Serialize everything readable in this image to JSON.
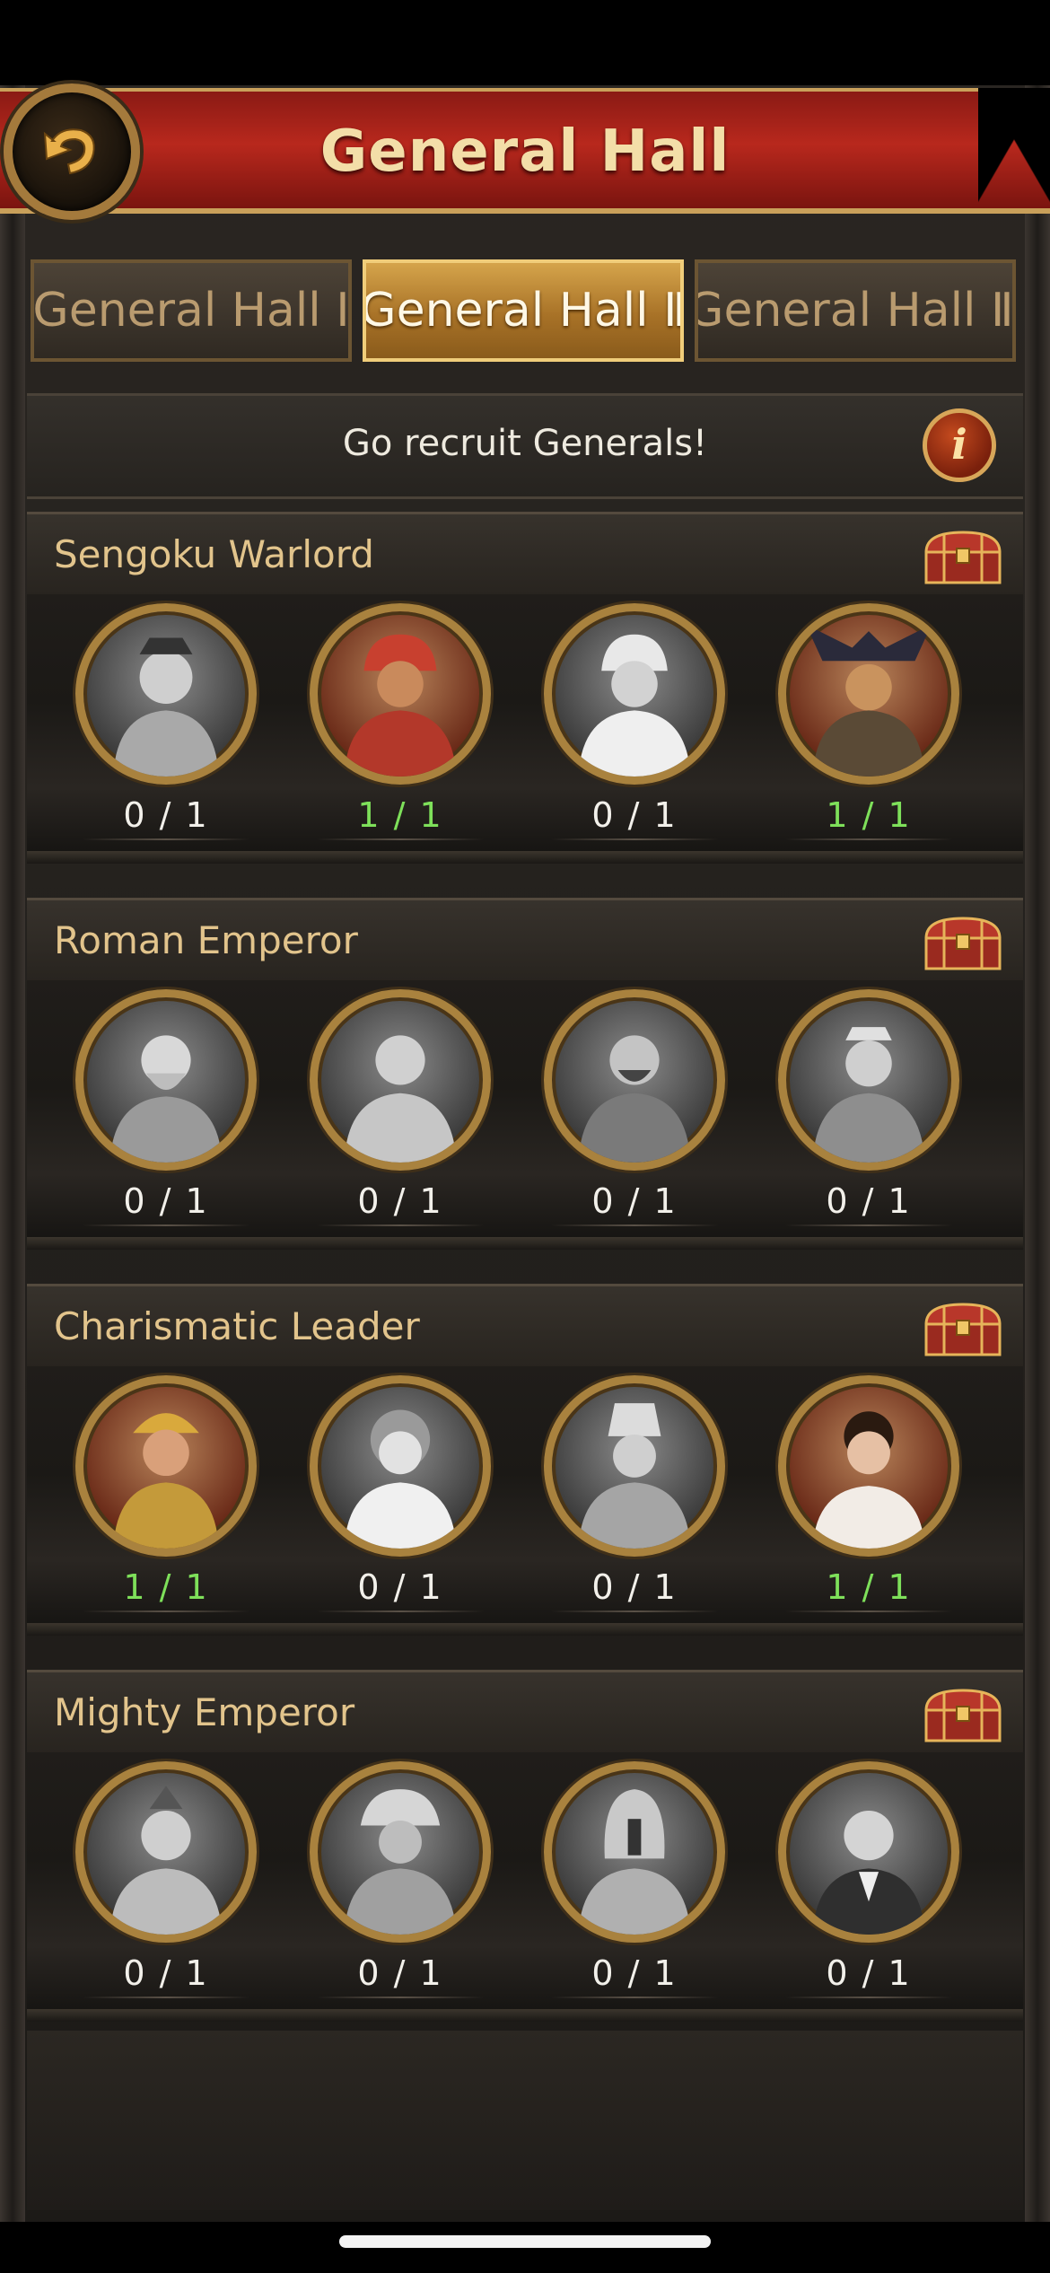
{
  "header": {
    "title": "General Hall"
  },
  "tabs": [
    {
      "label": "General Hall Ⅰ",
      "active": false
    },
    {
      "label": "General Hall Ⅱ",
      "active": true
    },
    {
      "label": "General Hall Ⅲ",
      "active": false
    }
  ],
  "recruit": {
    "text": "Go recruit Generals!",
    "info_icon": "i"
  },
  "sections": [
    {
      "title": "Sengoku Warlord",
      "generals": [
        {
          "count": "0 / 1",
          "owned": false
        },
        {
          "count": "1 / 1",
          "owned": true
        },
        {
          "count": "0 / 1",
          "owned": false
        },
        {
          "count": "1 / 1",
          "owned": true
        }
      ]
    },
    {
      "title": "Roman Emperor",
      "generals": [
        {
          "count": "0 / 1",
          "owned": false
        },
        {
          "count": "0 / 1",
          "owned": false
        },
        {
          "count": "0 / 1",
          "owned": false
        },
        {
          "count": "0 / 1",
          "owned": false
        }
      ]
    },
    {
      "title": "Charismatic Leader",
      "generals": [
        {
          "count": "1 / 1",
          "owned": true
        },
        {
          "count": "0 / 1",
          "owned": false
        },
        {
          "count": "0 / 1",
          "owned": false
        },
        {
          "count": "1 / 1",
          "owned": true
        }
      ]
    },
    {
      "title": "Mighty Emperor",
      "generals": [
        {
          "count": "0 / 1",
          "owned": false
        },
        {
          "count": "0 / 1",
          "owned": false
        },
        {
          "count": "0 / 1",
          "owned": false
        },
        {
          "count": "0 / 1",
          "owned": false
        }
      ]
    }
  ],
  "colors": {
    "owned": "#7ee05a",
    "not_owned": "#f2f0ea",
    "title_gold": "#e2c48c",
    "header_red": "#b8281d"
  }
}
